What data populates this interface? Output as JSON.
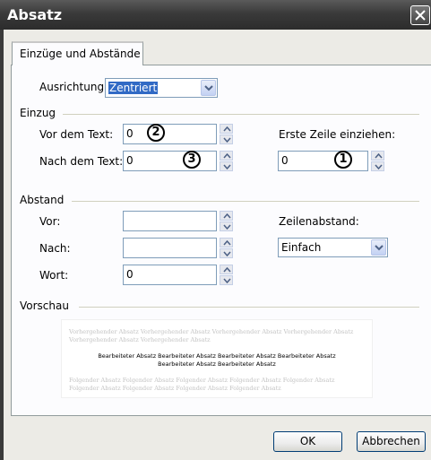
{
  "dialog": {
    "title": "Absatz"
  },
  "tabs": [
    {
      "label": "Einzüge und Abstände"
    }
  ],
  "alignment": {
    "label": "Ausrichtung:",
    "value": "Zentriert"
  },
  "einzug": {
    "group_label": "Einzug",
    "vor_label": "Vor dem Text:",
    "vor_value": "0",
    "nach_label": "Nach dem Text:",
    "nach_value": "0",
    "erste_label": "Erste Zeile einziehen:",
    "erste_value": "0"
  },
  "abstand": {
    "group_label": "Abstand",
    "vor_label": "Vor:",
    "vor_value": "",
    "nach_label": "Nach:",
    "nach_value": "",
    "wort_label": "Wort:",
    "wort_value": "0",
    "zeilen_label": "Zeilenabstand:",
    "zeilen_value": "Einfach"
  },
  "callouts": [
    "1",
    "2",
    "3"
  ],
  "vorschau": {
    "group_label": "Vorschau",
    "preceding_line1": "Vorhergehender Absatz Vorhergehender Absatz Vorhergehender Absatz Vorhergehender Absatz",
    "preceding_line2": "Vorhergehender Absatz Vorhergehender Absatz",
    "main_line1": "Bearbeiteter Absatz Bearbeiteter Absatz Bearbeiteter Absatz Bearbeiteter Absatz",
    "main_line2": "Bearbeiteter Absatz Bearbeiteter Absatz",
    "following_line1": "Folgender Absatz Folgender Absatz Folgender Absatz Folgender Absatz Folgender Absatz",
    "following_line2": "Folgender Absatz Folgender Absatz Folgender Absatz Folgender Absatz"
  },
  "buttons": {
    "ok": "OK",
    "cancel": "Abbrechen"
  }
}
